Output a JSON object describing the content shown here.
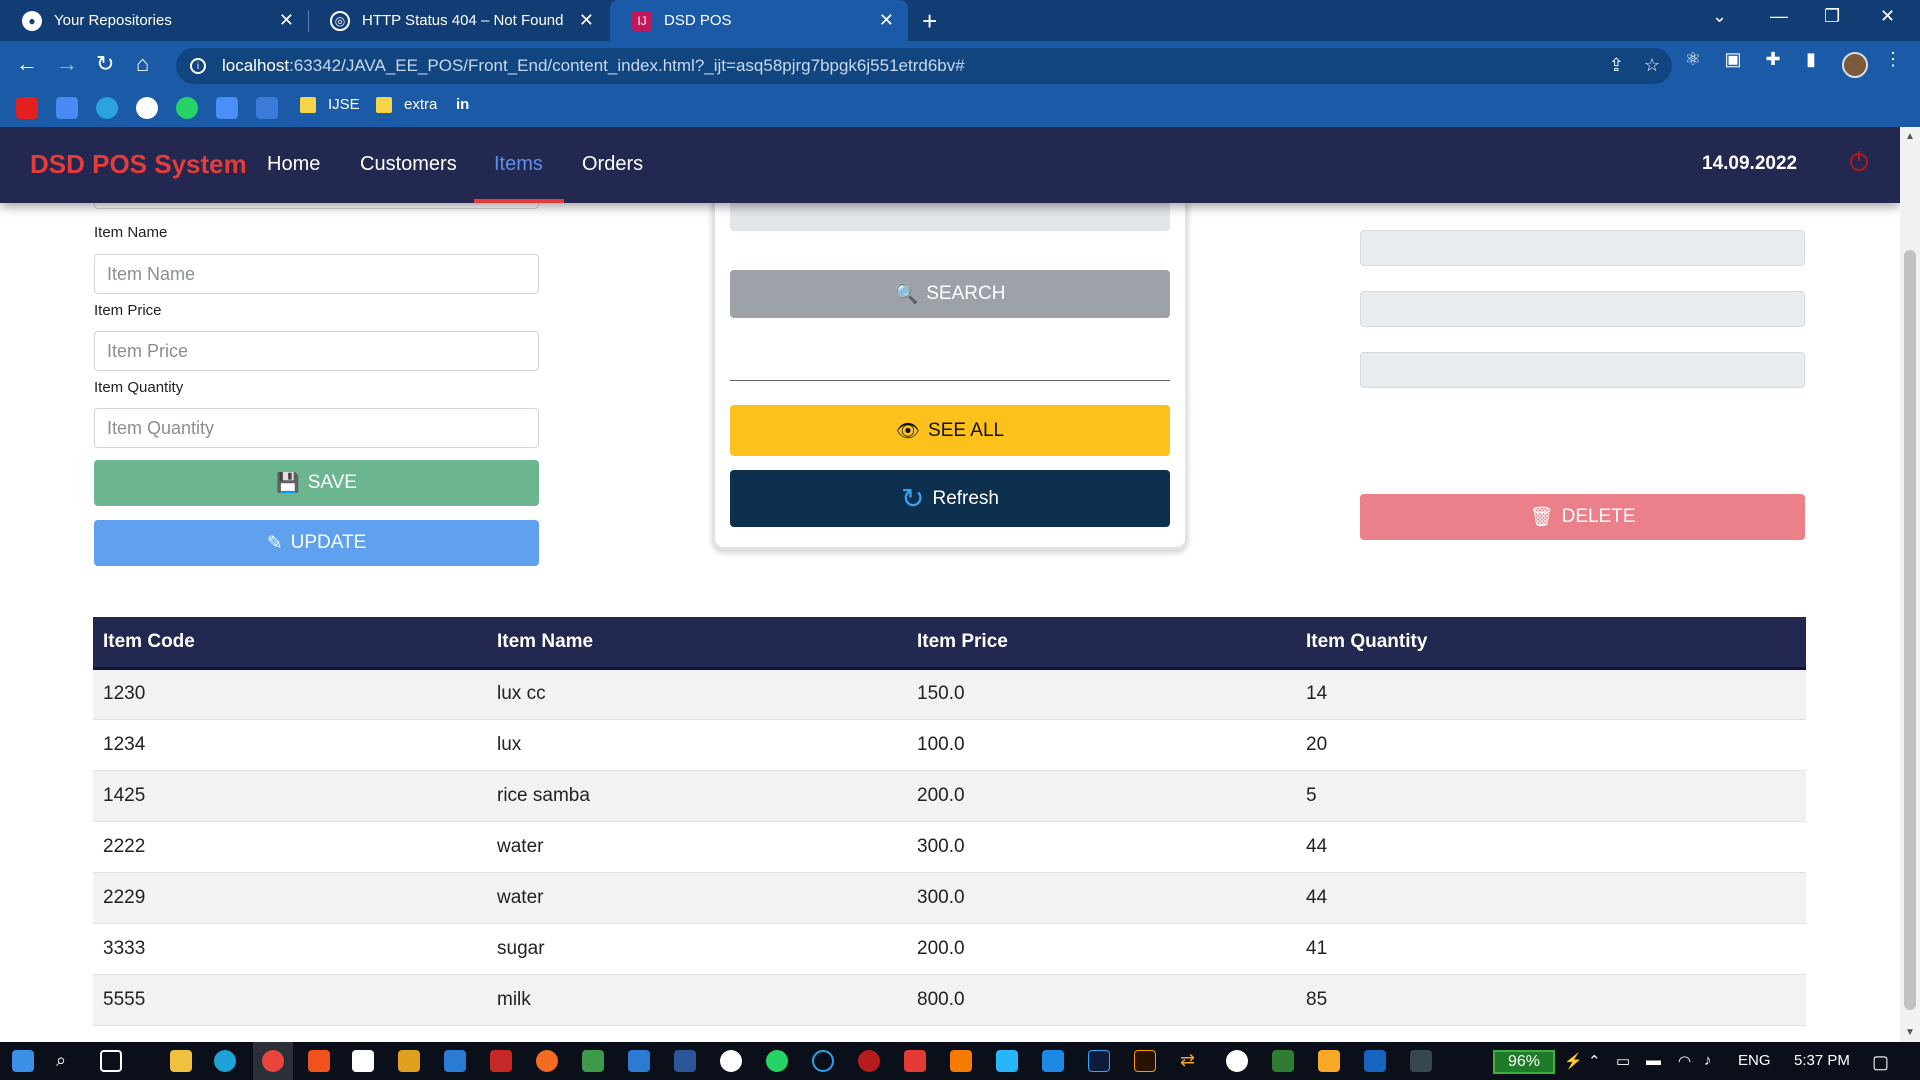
{
  "browser": {
    "tabs": [
      {
        "title": "Your Repositories",
        "icon": "github-icon"
      },
      {
        "title": "HTTP Status 404 – Not Found",
        "icon": "globe-icon"
      },
      {
        "title": "DSD POS",
        "icon": "intellij-icon"
      }
    ],
    "url_host": "localhost",
    "url_rest": ":63342/JAVA_EE_POS/Front_End/content_index.html?_ijt=asq58pjrg7bpgk6j551etrd6bv#",
    "bookmarks": {
      "folder1": "IJSE",
      "folder2": "extra",
      "linkedin": "in"
    }
  },
  "app": {
    "brand": "DSD POS System",
    "nav": [
      "Home",
      "Customers",
      "Items",
      "Orders"
    ],
    "active_nav": "Items",
    "date": "14.09.2022",
    "form": {
      "item_name_label": "Item Name",
      "item_name_placeholder": "Item Name",
      "item_price_label": "Item Price",
      "item_price_placeholder": "Item Price",
      "item_qty_label": "Item Quantity",
      "item_qty_placeholder": "Item Quantity",
      "save": "SAVE",
      "update": "UPDATE"
    },
    "search": {
      "search_btn": "SEARCH",
      "see_all": "SEE ALL",
      "refresh": "Refresh"
    },
    "delete": "DELETE",
    "table": {
      "headers": [
        "Item Code",
        "Item Name",
        "Item Price",
        "Item Quantity"
      ],
      "rows": [
        [
          "1230",
          "lux cc",
          "150.0",
          "14"
        ],
        [
          "1234",
          "lux",
          "100.0",
          "20"
        ],
        [
          "1425",
          "rice samba",
          "200.0",
          "5"
        ],
        [
          "2222",
          "water",
          "300.0",
          "44"
        ],
        [
          "2229",
          "water",
          "300.0",
          "44"
        ],
        [
          "3333",
          "sugar",
          "200.0",
          "41"
        ],
        [
          "5555",
          "milk",
          "800.0",
          "85"
        ]
      ]
    }
  },
  "taskbar": {
    "battery": "96%",
    "lang": "ENG",
    "time": "5:37 PM"
  },
  "colors": {
    "navbar": "#22284f",
    "brand": "#e63b3b",
    "save": "#6bb591",
    "update": "#5fa0ef",
    "see_all": "#fcc21b",
    "refresh": "#0c2f4e",
    "delete": "#eb808a"
  }
}
